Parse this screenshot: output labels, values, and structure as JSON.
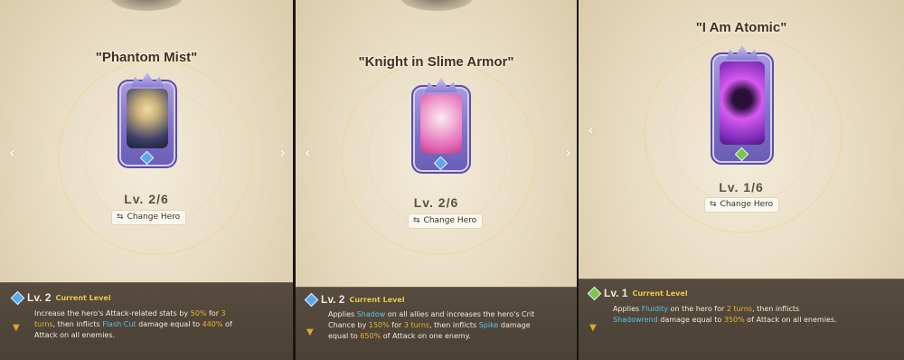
{
  "panels": [
    {
      "title": "\"Phantom Mist\"",
      "level_text": "Lv. 2/6",
      "change_hero_label": "Change Hero",
      "skill_level_label": "Lv. 2",
      "current_level_label": "Current Level",
      "description": {
        "p1": "Increase the hero's Attack-related stats by ",
        "v1": "50%",
        "p2": " for ",
        "v2": "3",
        "p3": "turns",
        "p4": ", then inflicts ",
        "kw": "Flash Cut",
        "p5": " damage equal to ",
        "v3": "440%",
        "p6": " of Attack on all enemies."
      },
      "gem_color": "#5aa9e8",
      "art_colors": [
        "#3a3f66",
        "#c9b07a"
      ]
    },
    {
      "title": "\"Knight in Slime Armor\"",
      "level_text": "Lv. 2/6",
      "change_hero_label": "Change Hero",
      "skill_level_label": "Lv. 2",
      "current_level_label": "Current Level",
      "description": {
        "p1": "Applies ",
        "kw1": "Shadow",
        "p2": " on all allies and increases the hero's Crit Chance by ",
        "v1": "150%",
        "p3": " for ",
        "v2": "3 turns",
        "p4": ", then inflicts ",
        "kw2": "Spike",
        "p5": " damage equal to ",
        "v3": "650%",
        "p6": " of Attack on one enemy."
      },
      "gem_color": "#5aa9e8",
      "art_colors": [
        "#e46ab8",
        "#f2b5d9"
      ]
    },
    {
      "title": "\"I Am Atomic\"",
      "level_text": "Lv. 1/6",
      "change_hero_label": "Change Hero",
      "skill_level_label": "Lv. 1",
      "current_level_label": "Current Level",
      "description": {
        "p1": "Applies ",
        "kw1": "Fluidity",
        "p2": " on the hero for ",
        "v1": "2 turns",
        "p3": ", then inflicts ",
        "kw2": "Shadowrend",
        "p4": " damage equal to ",
        "v2": "350%",
        "p5": " of Attack on all enemies."
      },
      "gem_color": "#7bc64a",
      "art_colors": [
        "#7d2bb8",
        "#d65af0"
      ]
    }
  ],
  "icons": {
    "left_arrow": "chevron-left-icon",
    "right_arrow": "chevron-right-icon",
    "swap": "swap-icon",
    "level_gem": "diamond-gem-icon",
    "expand": "chevron-down-icon"
  }
}
